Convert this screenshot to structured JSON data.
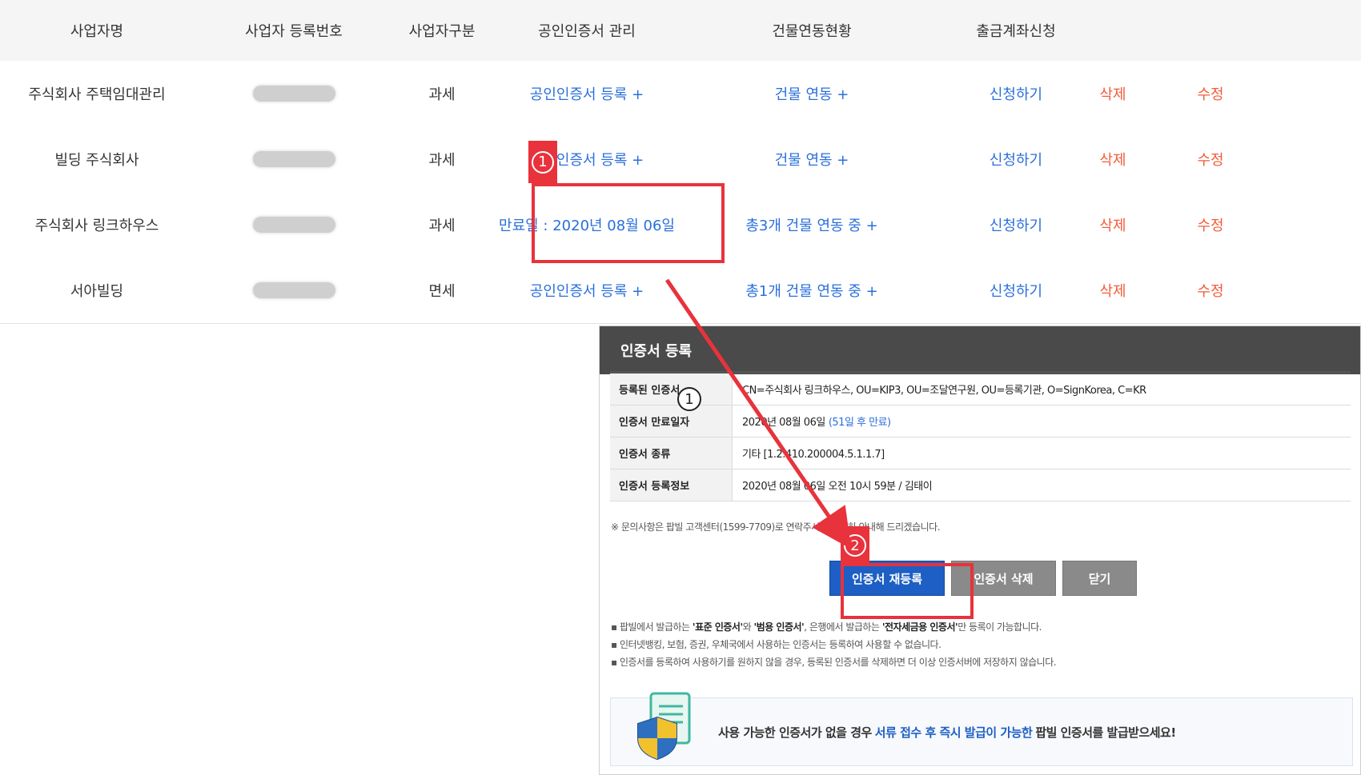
{
  "table": {
    "headers": [
      "사업자명",
      "사업자 등록번호",
      "사업자구분",
      "공인인증서 관리",
      "건물연동현황",
      "출금계좌신청"
    ],
    "rows": [
      {
        "name": "주식회사 주택임대관리",
        "type": "과세",
        "cert": "공인인증서 등록 +",
        "building": "건물 연동 +",
        "apply": "신청하기",
        "delete": "삭제",
        "edit": "수정"
      },
      {
        "name": "빌딩 주식회사",
        "type": "과세",
        "cert": "공인인증서 등록 +",
        "building": "건물 연동 +",
        "apply": "신청하기",
        "delete": "삭제",
        "edit": "수정"
      },
      {
        "name": "주식회사 링크하우스",
        "type": "과세",
        "cert": "만료일 : 2020년 08월 06일",
        "building": "총3개 건물 연동 중 +",
        "apply": "신청하기",
        "delete": "삭제",
        "edit": "수정"
      },
      {
        "name": "서아빌딩",
        "type": "면세",
        "cert": "공인인증서 등록 +",
        "building": "총1개 건물 연동 중 +",
        "apply": "신청하기",
        "delete": "삭제",
        "edit": "수정"
      }
    ]
  },
  "annotations": {
    "step1": "1",
    "step2": "2"
  },
  "modal": {
    "title": "인증서 등록",
    "rows": [
      {
        "label": "등록된 인증서",
        "value": "CN=주식회사 링크하우스, OU=KIP3, OU=조달연구원, OU=등록기관, O=SignKorea, C=KR",
        "extra": ""
      },
      {
        "label": "인증서 만료일자",
        "value": "2020년 08월 06일",
        "extra": "(51일 후 만료)"
      },
      {
        "label": "인증서 종류",
        "value": "기타 [1.2.410.200004.5.1.1.7]",
        "extra": ""
      },
      {
        "label": "인증서 등록정보",
        "value": "2020년 08월 06일 오전 10시 59분 / 김태이",
        "extra": ""
      }
    ],
    "note": "※ 문의사항은 팝빌 고객센터(1599-7709)로 연락주시면 친절히 안내해 드리겠습니다.",
    "buttons": {
      "reregister": "인증서 재등록",
      "delete": "인증서 삭제",
      "close": "닫기"
    },
    "bullets": {
      "b1_pre": "팝빌에서 발급하는 ",
      "b1_std": "'표준 인증서'",
      "b1_mid": "와 ",
      "b1_gen": "'범용 인증서'",
      "b1_mid2": ", 은행에서 발급하는 ",
      "b1_fin": "'전자세금용 인증서'",
      "b1_post": "만 등록이 가능합니다.",
      "b2": "인터넷뱅킹, 보험, 증권, 우체국에서 사용하는 인증서는 등록하여 사용할 수 없습니다.",
      "b3": "인증서를 등록하여 사용하기를 원하지 않을 경우, 등록된 인증서를 삭제하면 더 이상 인증서버에 저장하지 않습니다."
    },
    "promo": {
      "pre": "사용 가능한 인증서가 없을 경우",
      "highlight": "서류 접수 후 즉시 발급이 가능한",
      "post": "팝빌 인증서를 발급받으세요!"
    }
  }
}
